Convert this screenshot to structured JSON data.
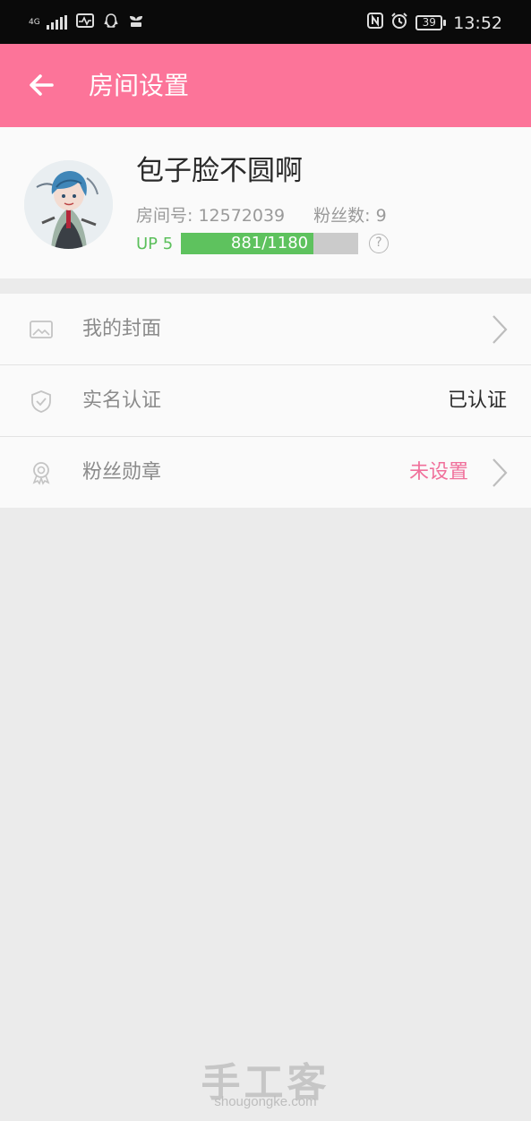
{
  "status_bar": {
    "network": "4G",
    "battery": "39",
    "time": "13:52",
    "icons": [
      "signal-icon",
      "health-icon",
      "qq-icon",
      "sprout-icon",
      "nfc-icon",
      "alarm-icon",
      "battery-icon"
    ]
  },
  "header": {
    "title": "房间设置",
    "back_icon": "arrow-left-icon",
    "bg_color": "#fc7499"
  },
  "profile": {
    "nickname": "包子脸不圆啊",
    "room_label": "房间号: 12572039",
    "fans_label": "粉丝数: 9",
    "level": "UP 5",
    "exp_text": "881/1180",
    "exp_fraction": 0.7466,
    "help_glyph": "?"
  },
  "settings": [
    {
      "label": "我的封面",
      "value": "",
      "icon": "image-icon"
    },
    {
      "label": "实名认证",
      "value": "已认证",
      "icon": "shield-check-icon"
    },
    {
      "label": "粉丝勋章",
      "value": "未设置",
      "icon": "medal-icon"
    }
  ],
  "watermark": {
    "cn": "手工客",
    "en": "shougongke.com"
  },
  "colors": {
    "accent_pink": "#fc7499",
    "value_pink": "#f0709b",
    "progress_green": "#5ec25e"
  }
}
